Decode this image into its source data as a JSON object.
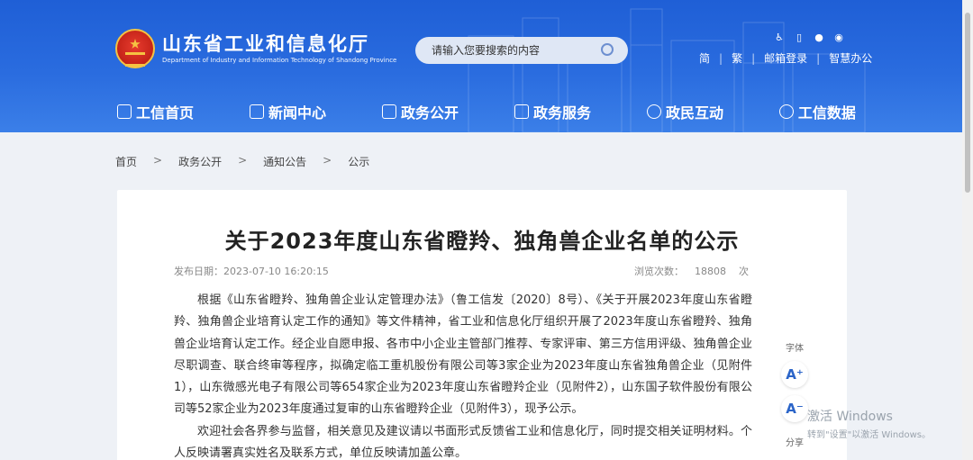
{
  "header": {
    "title_cn": "山东省工业和信息化厅",
    "title_en": "Department of Industry and Information Technology of Shandong Province",
    "search_placeholder": "请输入您要搜索的内容",
    "links": [
      "简",
      "繁",
      "邮箱登录",
      "智慧办公"
    ]
  },
  "nav": {
    "items": [
      {
        "label": "工信首页",
        "icon": "home-icon"
      },
      {
        "label": "新闻中心",
        "icon": "news-icon"
      },
      {
        "label": "政务公开",
        "icon": "monitor-icon"
      },
      {
        "label": "政务服务",
        "icon": "service-icon"
      },
      {
        "label": "政民互动",
        "icon": "chat-icon"
      },
      {
        "label": "工信数据",
        "icon": "database-icon"
      }
    ]
  },
  "breadcrumb": [
    "首页",
    "政务公开",
    "通知公告",
    "公示"
  ],
  "breadcrumb_sep": ">",
  "article": {
    "title": "关于2023年度山东省瞪羚、独角兽企业名单的公示",
    "date_label": "发布日期：",
    "date": "2023-07-10 16:20:15",
    "views_label": "浏览次数：",
    "views": "18808",
    "views_unit": "次",
    "paragraphs": [
      "根据《山东省瞪羚、独角兽企业认定管理办法》（鲁工信发〔2020〕8号）、《关于开展2023年度山东省瞪羚、独角兽企业培育认定工作的通知》等文件精神，省工业和信息化厅组织开展了2023年度山东省瞪羚、独角兽企业培育认定工作。经企业自愿申报、各市中小企业主管部门推荐、专家评审、第三方信用评级、独角兽企业尽职调查、联合终审等程序，拟确定临工重机股份有限公司等3家企业为2023年度山东省独角兽企业（见附件1），山东微感光电子有限公司等654家企业为2023年度山东省瞪羚企业（见附件2），山东国子软件股份有限公司等52家企业为2023年度通过复审的山东省瞪羚企业（见附件3），现予公示。",
      "欢迎社会各界参与监督，相关意见及建议请以书面形式反馈省工业和信息化厅，同时提交相关证明材料。个人反映请署真实姓名及联系方式，单位反映请加盖公章。"
    ]
  },
  "side": {
    "font_label": "字体",
    "font_up": "A⁺",
    "font_down": "A⁻",
    "share_label": "分享"
  },
  "watermark": {
    "line1": "激活 Windows",
    "line2": "转到\"设置\"以激活 Windows。"
  }
}
